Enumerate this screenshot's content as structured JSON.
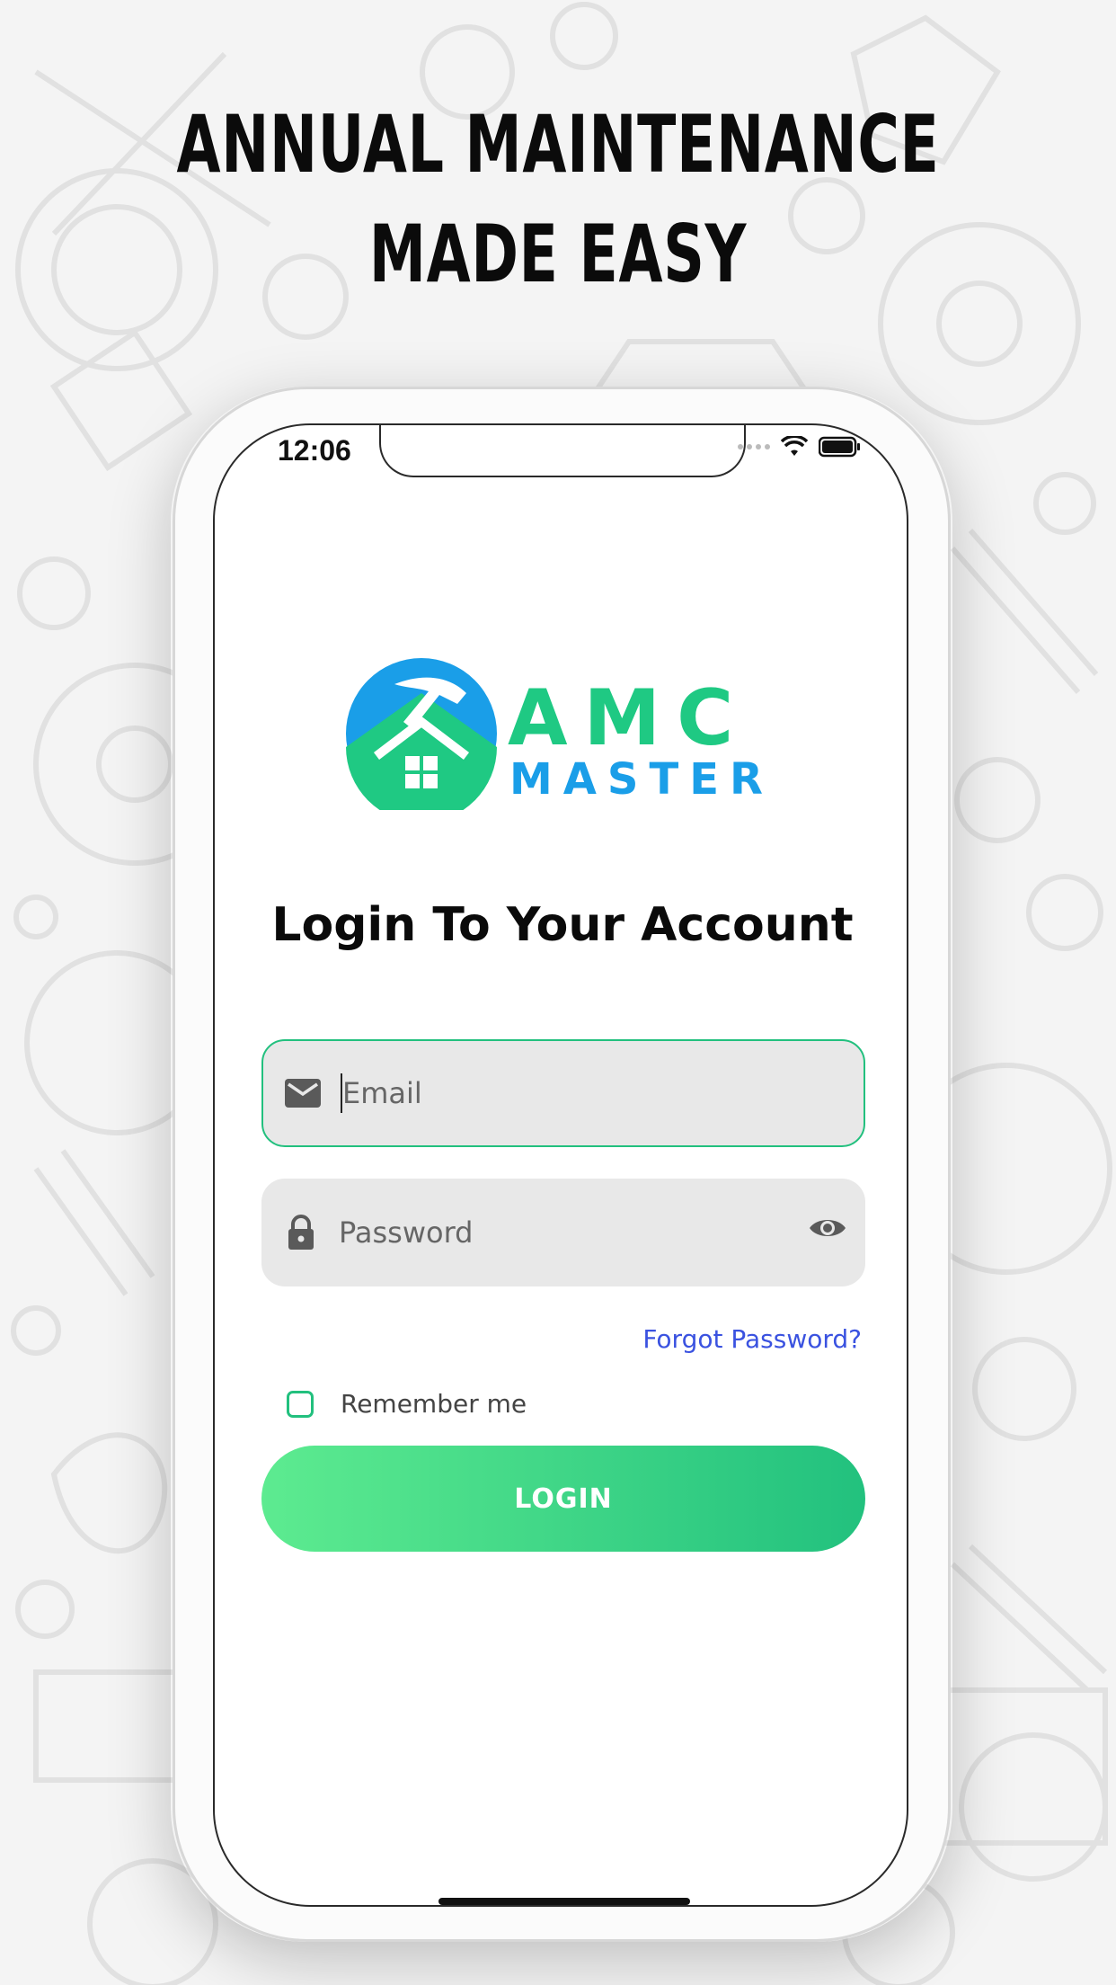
{
  "headline": {
    "line1": "ANNUAL MAINTENANCE",
    "line2": "MADE EASY"
  },
  "status_bar": {
    "time": "12:06"
  },
  "logo": {
    "line1": "AMC",
    "line2": "MASTER",
    "colors": {
      "green": "#1fc983",
      "blue": "#1a9ee8"
    }
  },
  "login": {
    "title": "Login To Your Account",
    "email_placeholder": "Email",
    "password_placeholder": "Password",
    "forgot_password": "Forgot Password?",
    "remember_me": "Remember me",
    "remember_checked": false,
    "button_label": "LOGIN"
  },
  "icons": {
    "email": "mail-icon",
    "password": "lock-icon",
    "visibility": "eye-icon",
    "wifi": "wifi-icon",
    "battery": "battery-icon"
  },
  "colors": {
    "accent": "#22c07e",
    "link": "#3a52e0",
    "field_bg": "#e8e8e8"
  }
}
